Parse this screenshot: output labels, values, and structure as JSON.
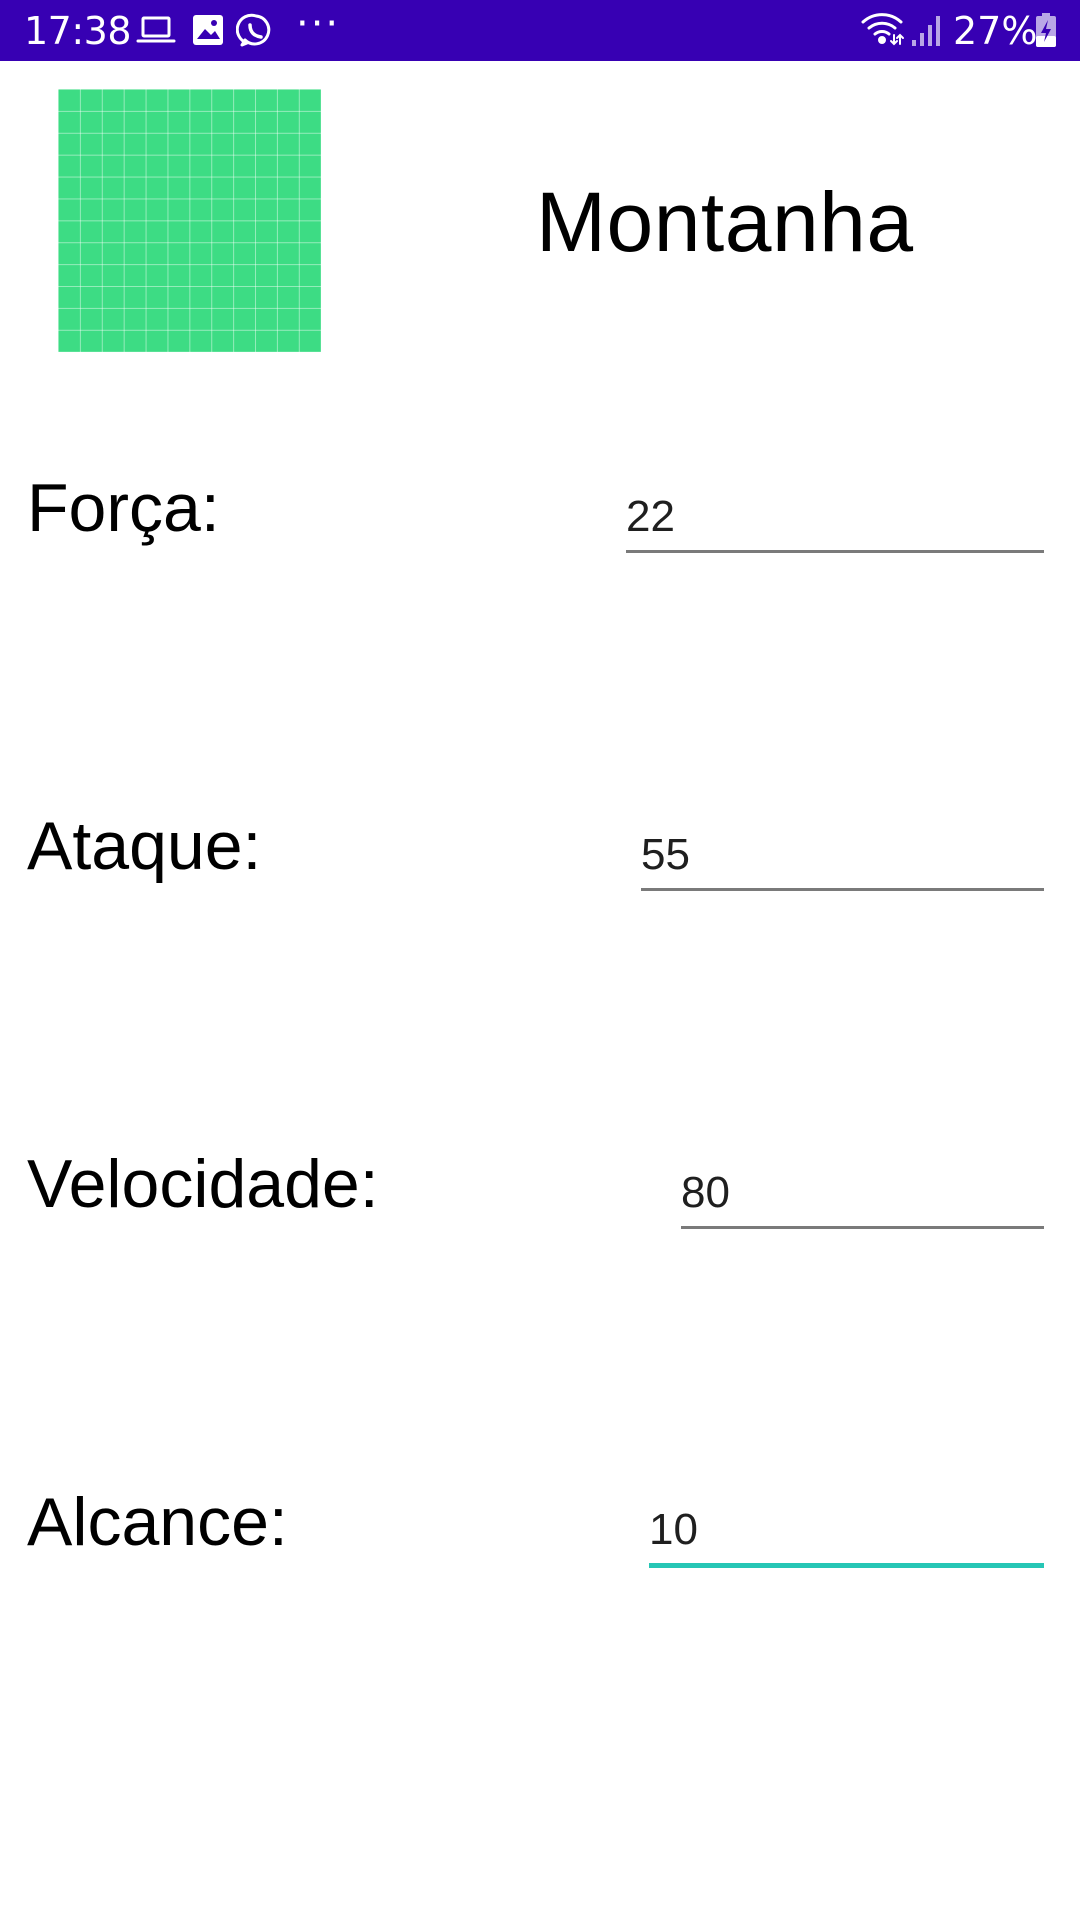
{
  "status_bar": {
    "time": "17:38",
    "icons": [
      "laptop-icon",
      "image-icon",
      "whatsapp-icon"
    ],
    "more": "···",
    "battery_percent": "27%",
    "background": "#3700b3"
  },
  "header": {
    "image_icon": "character-image",
    "image_color": "#3ddc84",
    "name": "Montanha"
  },
  "stats": [
    {
      "label": "Força:",
      "value": "22"
    },
    {
      "label": "Ataque:",
      "value": "55"
    },
    {
      "label": "Velocidade:",
      "value": "80"
    },
    {
      "label": "Alcance:",
      "value": "10"
    }
  ],
  "colors": {
    "focused_underline": "#26c6b5",
    "underline": "#7a7a7a"
  }
}
